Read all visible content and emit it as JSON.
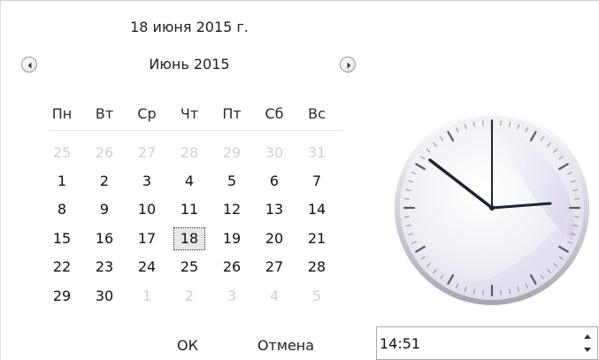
{
  "header": {
    "date_title": "18 июня 2015 г.",
    "month_title": "Июнь 2015"
  },
  "weekdays": [
    "Пн",
    "Вт",
    "Ср",
    "Чт",
    "Пт",
    "Сб",
    "Вс"
  ],
  "weeks": [
    [
      "25",
      "26",
      "27",
      "28",
      "29",
      "30",
      "31"
    ],
    [
      "1",
      "2",
      "3",
      "4",
      "5",
      "6",
      "7"
    ],
    [
      "8",
      "9",
      "10",
      "11",
      "12",
      "13",
      "14"
    ],
    [
      "15",
      "16",
      "17",
      "18",
      "19",
      "20",
      "21"
    ],
    [
      "22",
      "23",
      "24",
      "25",
      "26",
      "27",
      "28"
    ],
    [
      "29",
      "30",
      "1",
      "2",
      "3",
      "4",
      "5"
    ]
  ],
  "selected_day": "18",
  "buttons": {
    "ok": "ОК",
    "cancel": "Отмена"
  },
  "time": {
    "value": "14:51"
  },
  "colors": {
    "muted_day": "#cfcfcf",
    "today_bg": "#e7e7e7",
    "clock_hands": "#1b2333",
    "clock_face": "#f4f2f8"
  },
  "icons": {
    "prev": "left-arrow-circle-icon",
    "next": "right-arrow-circle-icon",
    "spin_up": "caret-up-icon",
    "spin_down": "caret-down-icon"
  }
}
